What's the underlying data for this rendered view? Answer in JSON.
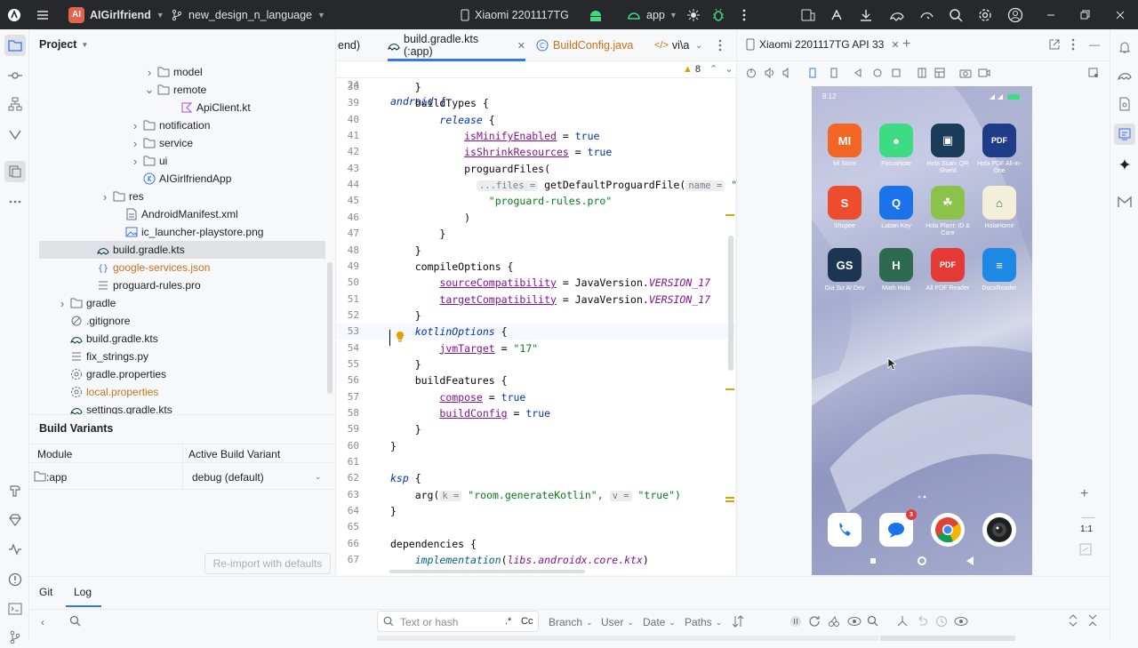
{
  "titlebar": {
    "project_badge": "AI",
    "project_name": "AIGirlfriend",
    "branch": "new_design_n_language",
    "device": "Xiaomi 2201117TG",
    "run_config": "app"
  },
  "project_panel": {
    "title": "Project",
    "tree": [
      {
        "label": "model",
        "type": "folder",
        "expanded": false
      },
      {
        "label": "remote",
        "type": "folder",
        "expanded": true
      },
      {
        "label": "ApiClient.kt",
        "type": "kotlin"
      },
      {
        "label": "notification",
        "type": "folder",
        "expanded": false
      },
      {
        "label": "service",
        "type": "folder",
        "expanded": false
      },
      {
        "label": "ui",
        "type": "folder",
        "expanded": false
      },
      {
        "label": "AIGirlfriendApp",
        "type": "class"
      },
      {
        "label": "res",
        "type": "folder",
        "expanded": false
      },
      {
        "label": "AndroidManifest.xml",
        "type": "xml"
      },
      {
        "label": "ic_launcher-playstore.png",
        "type": "image"
      },
      {
        "label": "build.gradle.kts",
        "type": "gradle",
        "selected": true
      },
      {
        "label": "google-services.json",
        "type": "json"
      },
      {
        "label": "proguard-rules.pro",
        "type": "text"
      },
      {
        "label": "gradle",
        "type": "folder",
        "expanded": false
      },
      {
        "label": ".gitignore",
        "type": "ignore"
      },
      {
        "label": "build.gradle.kts",
        "type": "gradle"
      },
      {
        "label": "fix_strings.py",
        "type": "text"
      },
      {
        "label": "gradle.properties",
        "type": "settings"
      },
      {
        "label": "local.properties",
        "type": "settings"
      },
      {
        "label": "settings.gradle.kts",
        "type": "gradle"
      }
    ]
  },
  "build_variants": {
    "title": "Build Variants",
    "col_module": "Module",
    "col_variant": "Active Build Variant",
    "module": ":app",
    "variant": "debug (default)",
    "reimport": "Re-import with defaults"
  },
  "editor": {
    "tabs": [
      {
        "label": "end)"
      },
      {
        "label": "build.gradle.kts (:app)",
        "active": true
      },
      {
        "label": "BuildConfig.java"
      },
      {
        "label": "vi\\a"
      }
    ],
    "sticky": {
      "num": "24",
      "text": "android {"
    },
    "warnings": "8",
    "lines": [
      {
        "num": "38",
        "text": "    }"
      },
      {
        "num": "39",
        "text": "    buildTypes {"
      },
      {
        "num": "40",
        "text": "        release {"
      },
      {
        "num": "41",
        "text": "            isMinifyEnabled = true"
      },
      {
        "num": "42",
        "text": "            isShrinkResources = true"
      },
      {
        "num": "43",
        "text": "            proguardFiles("
      },
      {
        "num": "44",
        "text": "getDefaultProguardFile("
      },
      {
        "num": "45",
        "text": "                \"proguard-rules.pro\""
      },
      {
        "num": "46",
        "text": "            )"
      },
      {
        "num": "47",
        "text": "        }"
      },
      {
        "num": "48",
        "text": "    }"
      },
      {
        "num": "49",
        "text": "    compileOptions {"
      },
      {
        "num": "50",
        "text": "        sourceCompatibility = JavaVersion.VERSION_17"
      },
      {
        "num": "51",
        "text": "        targetCompatibility = JavaVersion.VERSION_17"
      },
      {
        "num": "52",
        "text": "    }"
      },
      {
        "num": "53",
        "text": "    kotlinOptions {"
      },
      {
        "num": "54",
        "text": "        jvmTarget = \"17\""
      },
      {
        "num": "55",
        "text": "    }"
      },
      {
        "num": "56",
        "text": "    buildFeatures {"
      },
      {
        "num": "57",
        "text": "        compose = true"
      },
      {
        "num": "58",
        "text": "        buildConfig = true"
      },
      {
        "num": "59",
        "text": "    }"
      },
      {
        "num": "60",
        "text": "}"
      },
      {
        "num": "61",
        "text": ""
      },
      {
        "num": "62",
        "text": "ksp {"
      },
      {
        "num": "63",
        "text": "arg("
      },
      {
        "num": "64",
        "text": "}"
      },
      {
        "num": "65",
        "text": ""
      },
      {
        "num": "66",
        "text": "dependencies {"
      },
      {
        "num": "67",
        "text": "implementation(libs.androidx.core.ktx)"
      }
    ],
    "hints": {
      "files": "...files =",
      "name": "name =",
      "k": "k =",
      "v": "v ="
    },
    "hint_tail": "\"pro",
    "ksp_key": "\"room.generateKotlin\",",
    "ksp_val": "\"true\")"
  },
  "emulator": {
    "tab": "Xiaomi 2201117TG API 33",
    "status_time": "8:12",
    "zoom": "1:1",
    "apps": [
      {
        "label": "Mi Store",
        "glyph": "MI",
        "color": "#f26522"
      },
      {
        "label": "FocusNote",
        "glyph": "●",
        "color": "#3ddc84"
      },
      {
        "label": "Hola Scan: QR Shield",
        "glyph": "▣",
        "color": "#1b3b5a"
      },
      {
        "label": "Hola PDF All-in-One",
        "glyph": "PDF",
        "color": "#1f3c88"
      },
      {
        "label": "Shopee",
        "glyph": "S",
        "color": "#ee4d2d"
      },
      {
        "label": "Laban Key",
        "glyph": "Q",
        "color": "#1a73e8"
      },
      {
        "label": "Hola Plant: ID & Care",
        "glyph": "☘",
        "color": "#8bc34a"
      },
      {
        "label": "HolaHome",
        "glyph": "⌂",
        "color": "#f3efd9"
      },
      {
        "label": "Gia Sư AI Dev",
        "glyph": "GS",
        "color": "#1c3552"
      },
      {
        "label": "Math Hola",
        "glyph": "H",
        "color": "#2d6a4f"
      },
      {
        "label": "All PDF Reader",
        "glyph": "PDF",
        "color": "#e53935"
      },
      {
        "label": "DocxReader",
        "glyph": "≡",
        "color": "#1e88e5"
      }
    ],
    "dock_badge": "3"
  },
  "bottom": {
    "tab_git": "Git",
    "tab_log": "Log",
    "search_placeholder": "Text or hash",
    "regex": ".*",
    "case": "Cc",
    "filter_branch": "Branch",
    "filter_user": "User",
    "filter_date": "Date",
    "filter_paths": "Paths"
  }
}
